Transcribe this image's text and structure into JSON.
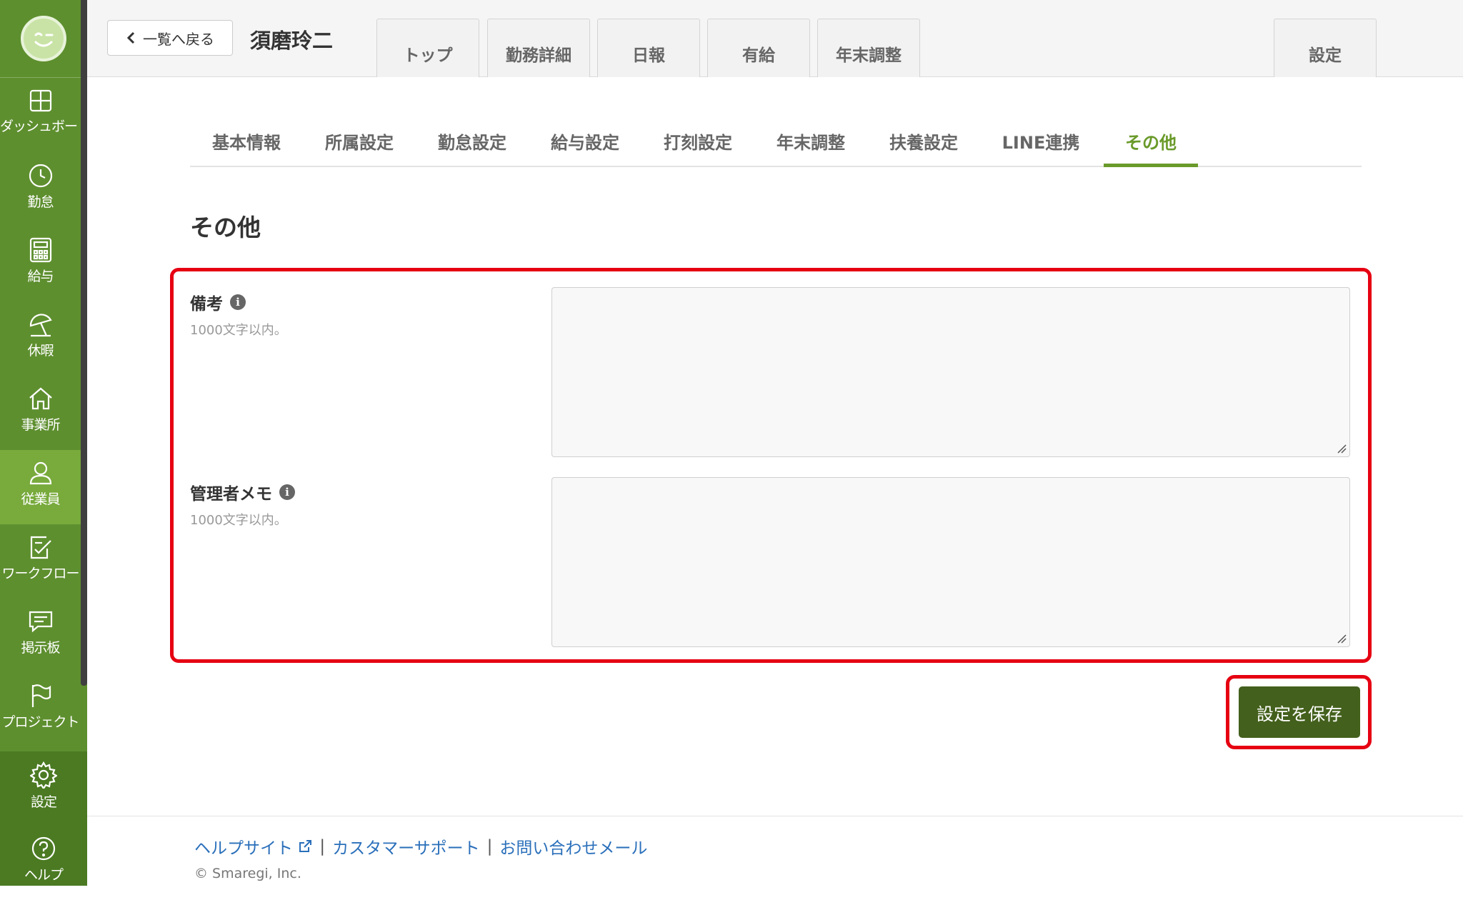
{
  "sidebar": {
    "items": [
      {
        "label": "ダッシュボード",
        "icon": "dashboard-icon"
      },
      {
        "label": "勤怠",
        "icon": "clock-icon"
      },
      {
        "label": "給与",
        "icon": "calculator-icon"
      },
      {
        "label": "休暇",
        "icon": "beach-umbrella-icon"
      },
      {
        "label": "事業所",
        "icon": "home-icon"
      },
      {
        "label": "従業員",
        "icon": "user-icon",
        "active": true
      },
      {
        "label": "ワークフロー",
        "icon": "checklist-icon"
      },
      {
        "label": "掲示板",
        "icon": "message-icon"
      },
      {
        "label": "プロジェクト",
        "icon": "flag-icon"
      }
    ],
    "bottom": [
      {
        "label": "設定",
        "icon": "gear-icon"
      },
      {
        "label": "ヘルプ",
        "icon": "help-icon"
      }
    ]
  },
  "header": {
    "back_label": "一覧へ戻る",
    "employee_name": "須磨玲二",
    "tabs": [
      "トップ",
      "勤務詳細",
      "日報",
      "有給",
      "年末調整"
    ],
    "settings_tab": "設定"
  },
  "subtabs": [
    "基本情報",
    "所属設定",
    "勤怠設定",
    "給与設定",
    "打刻設定",
    "年末調整",
    "扶養設定",
    "LINE連携",
    "その他"
  ],
  "active_subtab": "その他",
  "section_title": "その他",
  "form": {
    "fields": [
      {
        "label": "備考",
        "hint": "1000文字以内。",
        "value": ""
      },
      {
        "label": "管理者メモ",
        "hint": "1000文字以内。",
        "value": ""
      }
    ],
    "save_label": "設定を保存"
  },
  "footer": {
    "links": [
      "ヘルプサイト",
      "カスタマーサポート",
      "お問い合わせメール"
    ],
    "separator": "|",
    "copyright": "© Smaregi, Inc."
  },
  "colors": {
    "sidebar": "#5e8f2f",
    "sidebar_active": "#78aa3c",
    "accent": "#6a9a2a",
    "save_button": "#43601c",
    "highlight": "#e60012",
    "link": "#2a6fba"
  }
}
